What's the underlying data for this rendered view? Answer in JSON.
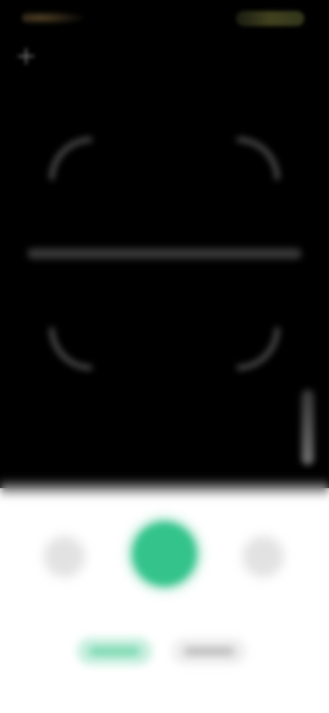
{
  "screen": {
    "mode": "scanner-camera",
    "background_color": "#000000",
    "panel_color": "#ffffff"
  },
  "status_bar": {
    "left_icon": "time-indicator",
    "right_icon": "battery-indicator"
  },
  "toolbar": {
    "back_icon": "plus-icon"
  },
  "viewfinder": {
    "corner_icon": "scan-corner",
    "scan_line_icon": "scan-line",
    "torch_icon": "torch-slider-icon"
  },
  "controls": {
    "gallery_icon": "gallery-icon",
    "shutter_icon": "shutter-icon",
    "shutter_color": "#33c38b",
    "flip_icon": "flip-camera-icon"
  },
  "mode_tabs": [
    {
      "id": "mode-1",
      "active": true,
      "accent": "#3ac48c"
    },
    {
      "id": "mode-2",
      "active": false,
      "accent": "#b4b4b4"
    }
  ]
}
